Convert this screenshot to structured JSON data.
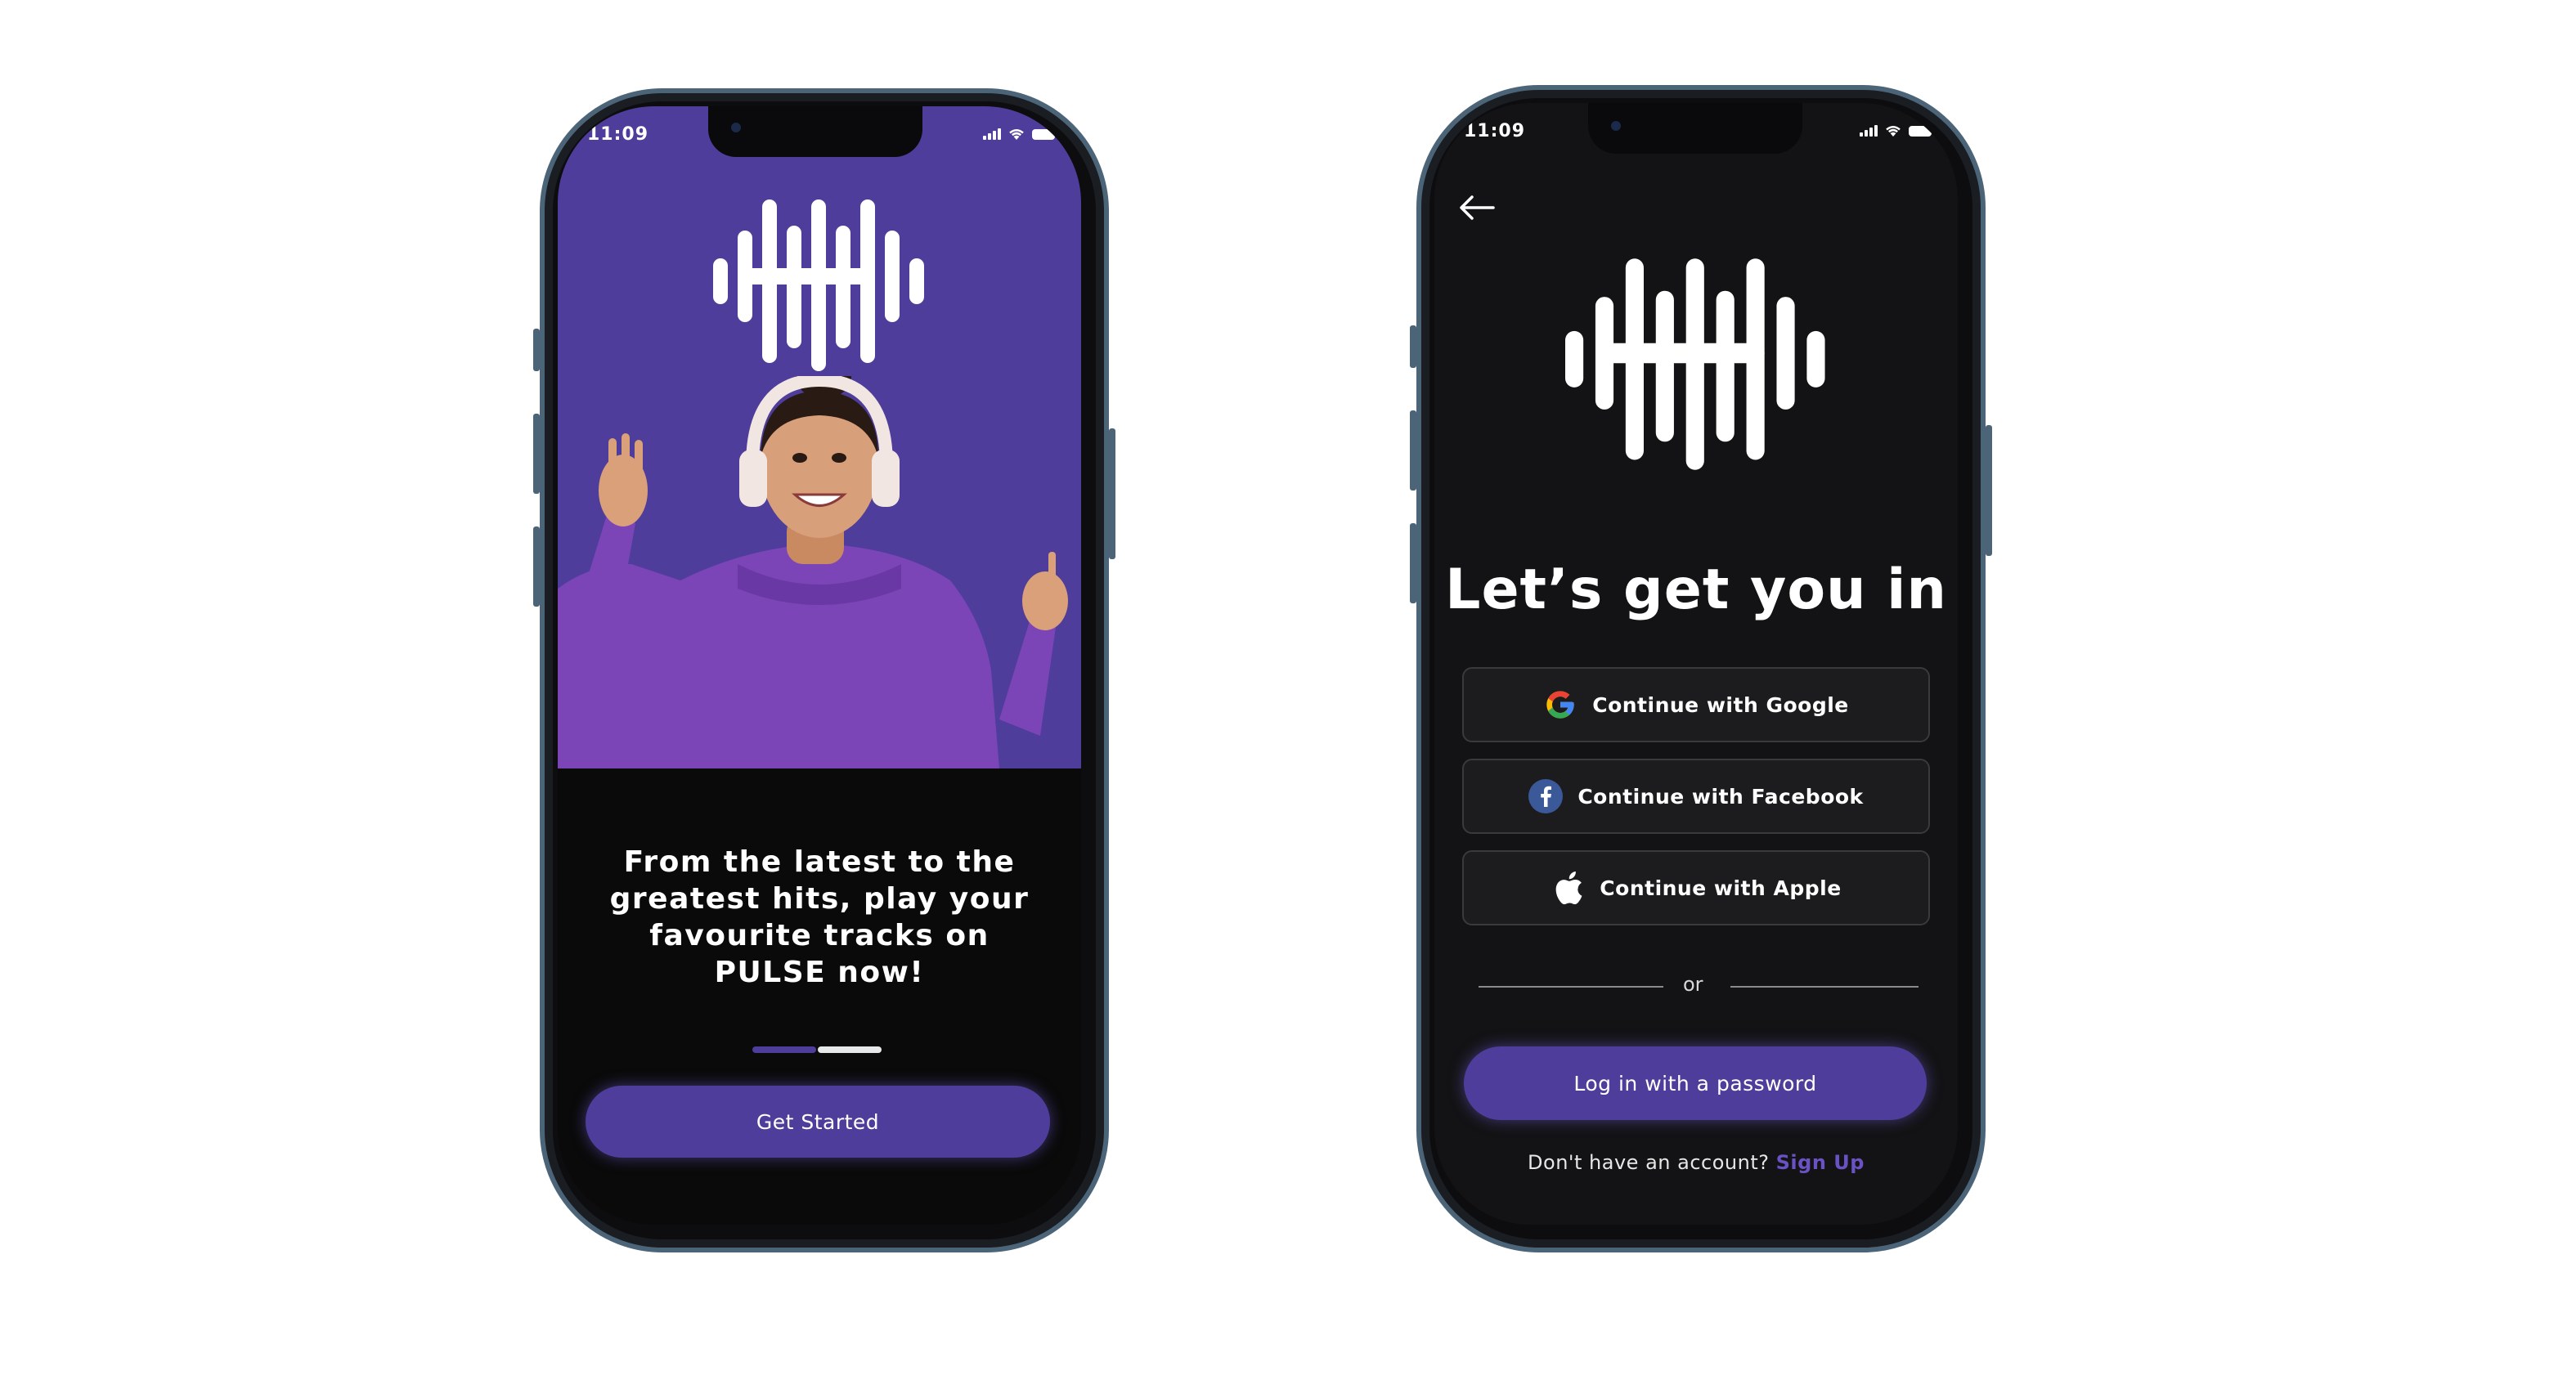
{
  "status": {
    "time": "11:09"
  },
  "onboarding": {
    "tagline": "From the latest to the greatest hits, play your favourite tracks on PULSE now!",
    "get_started_label": "Get Started",
    "progress": {
      "steps": 2,
      "active": 1
    }
  },
  "login": {
    "heading": "Let’s get you in",
    "google_label": "Continue with Google",
    "facebook_label": "Continue with Facebook",
    "apple_label": "Continue with Apple",
    "divider_text": "or",
    "password_login_label": "Log in with a password",
    "no_account_text": "Don't have an account?",
    "signup_label": "Sign Up"
  },
  "colors": {
    "brand_purple": "#4e3d9a",
    "screen_dark": "#131315",
    "link_purple": "#6a52c4",
    "google_blue": "#4285F4",
    "google_red": "#EA4335",
    "google_yellow": "#FBBC05",
    "google_green": "#34A853",
    "facebook_blue": "#3b5998"
  }
}
